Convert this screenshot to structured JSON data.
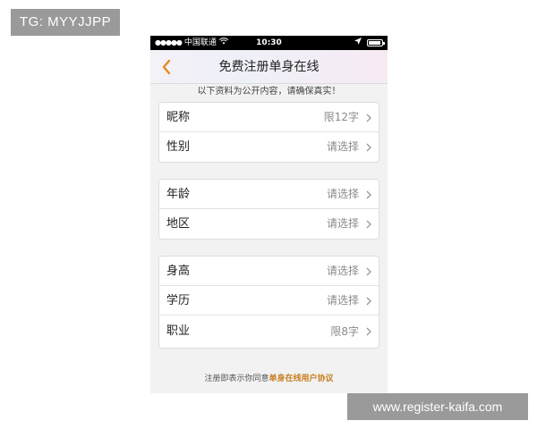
{
  "watermark": {
    "top_left": "TG: MYYJJPP",
    "bottom_right": "www.register-kaifa.com"
  },
  "status_bar": {
    "signal": "●●●●●",
    "carrier": "中国联通",
    "time": "10:30",
    "wifi_icon": "wifi-icon",
    "location_icon": "location-arrow-icon",
    "battery_icon": "battery-icon"
  },
  "nav": {
    "back_icon": "chevron-left-icon",
    "title": "免费注册单身在线"
  },
  "notice": "以下资料为公开内容，请确保真实！",
  "groups": [
    {
      "rows": [
        {
          "label": "昵称",
          "value": "限12字"
        },
        {
          "label": "性别",
          "value": "请选择"
        }
      ]
    },
    {
      "rows": [
        {
          "label": "年龄",
          "value": "请选择"
        },
        {
          "label": "地区",
          "value": "请选择"
        }
      ]
    },
    {
      "rows": [
        {
          "label": "身高",
          "value": "请选择"
        },
        {
          "label": "学历",
          "value": "请选择"
        },
        {
          "label": "职业",
          "value": "限8字"
        }
      ]
    }
  ],
  "footer": {
    "prefix": "注册即表示你同意",
    "link": "单身在线用户协议"
  },
  "colors": {
    "accent": "#c77e1f",
    "back_arrow": "#e8891a",
    "status_bar": "#000000",
    "background": "#f2f2f2"
  }
}
